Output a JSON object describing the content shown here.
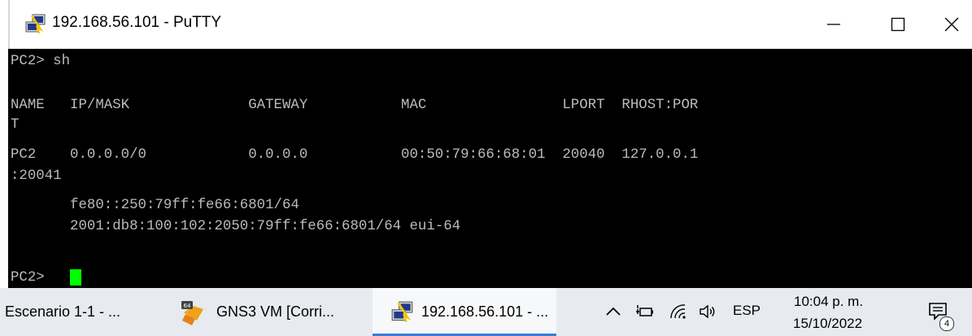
{
  "window": {
    "title": "192.168.56.101 - PuTTY",
    "icon": "putty-icon"
  },
  "window_controls": {
    "minimize_icon": "minimize-icon",
    "maximize_icon": "maximize-icon",
    "close_icon": "close-icon"
  },
  "terminal": {
    "background": "#000000",
    "text_color": "#bbbbbb",
    "cursor_color": "#00ff00",
    "lines": [
      "PC2> sh",
      "",
      "NAME   IP/MASK              GATEWAY           MAC                LPORT  RHOST:POR",
      "T",
      "PC2    0.0.0.0/0            0.0.0.0           00:50:79:66:68:01  20040  127.0.0.1",
      ":20041",
      "       fe80::250:79ff:fe66:6801/64",
      "       2001:db8:100:102:2050:79ff:fe66:6801/64 eui-64",
      "",
      "PC2> "
    ]
  },
  "taskbar": {
    "items": [
      {
        "label": "Escenario 1-1 - ...",
        "icon": ""
      },
      {
        "label": "GNS3 VM [Corri...",
        "icon": "virtualbox-icon"
      },
      {
        "label": "192.168.56.101 - ...",
        "icon": "putty-icon",
        "active": true
      }
    ],
    "tray": {
      "chevron_icon": "chevron-up-icon",
      "battery_icon": "battery-plug-icon",
      "wifi_icon": "wifi-icon",
      "volume_icon": "volume-icon",
      "language": "ESP",
      "time": "10:04 p. m.",
      "date": "15/10/2022",
      "notification_icon": "notification-icon",
      "notification_count": "4"
    },
    "accent": "#3a7bd5"
  }
}
